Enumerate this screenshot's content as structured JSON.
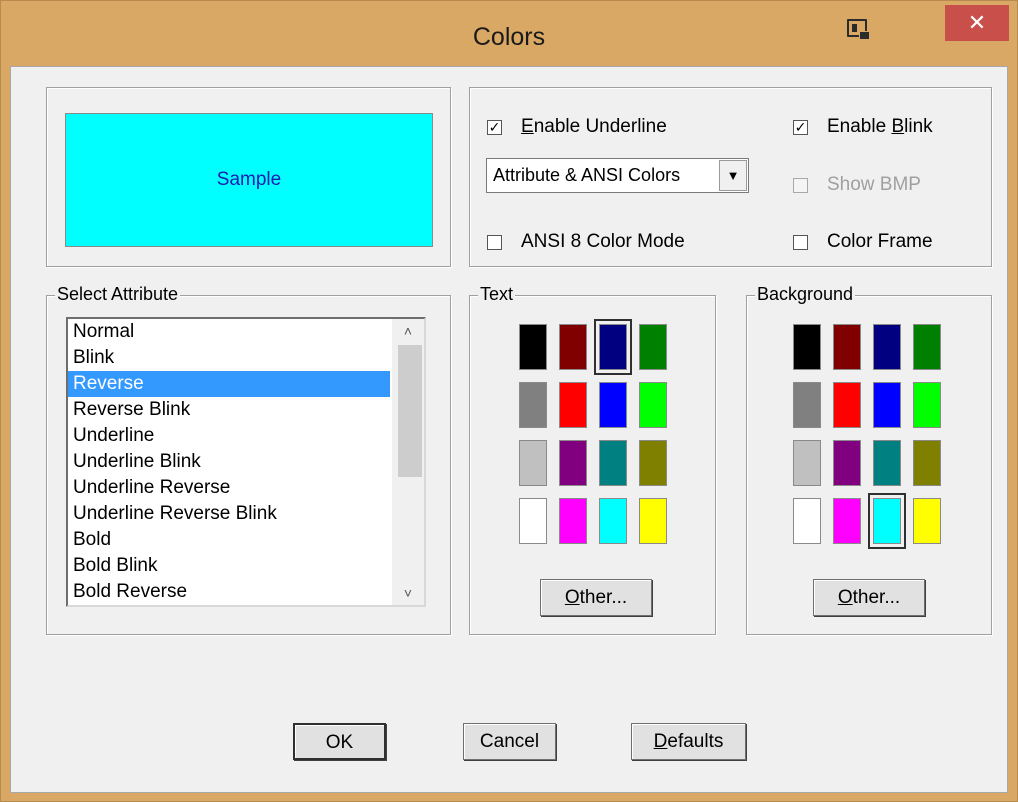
{
  "window": {
    "title": "Colors",
    "close_glyph": "✕",
    "icons": [
      "window-restore-icon",
      "close-icon"
    ]
  },
  "sample": {
    "label": "Sample",
    "background": "#00ffff",
    "text_color": "#1c1cb0"
  },
  "options": {
    "enable_underline": {
      "prefix": "",
      "accel": "E",
      "suffix": "nable Underline",
      "checked": true
    },
    "enable_blink": {
      "prefix": "Enable ",
      "accel": "B",
      "suffix": "link",
      "checked": true
    },
    "color_mode_combo": {
      "value": "Attribute & ANSI Colors"
    },
    "show_bmp": {
      "label": "Show BMP",
      "checked": false,
      "disabled": true
    },
    "ansi_8_color_mode": {
      "label": "ANSI 8 Color Mode",
      "checked": false
    },
    "color_frame": {
      "label": "Color Frame",
      "checked": false
    }
  },
  "select_attribute": {
    "label": "Select Attribute",
    "items": [
      "Normal",
      "Blink",
      "Reverse",
      "Reverse Blink",
      "Underline",
      "Underline Blink",
      "Underline Reverse",
      "Underline Reverse Blink",
      "Bold",
      "Bold Blink",
      "Bold Reverse"
    ],
    "selected": "Reverse"
  },
  "text_colors": {
    "label": "Text",
    "palette": [
      "#000000",
      "#800000",
      "#000080",
      "#008000",
      "#808080",
      "#ff0000",
      "#0000ff",
      "#00ff00",
      "#c0c0c0",
      "#800080",
      "#008080",
      "#808000",
      "#ffffff",
      "#ff00ff",
      "#00ffff",
      "#ffff00"
    ],
    "selected": "#000080",
    "other": {
      "accel": "O",
      "suffix": "ther..."
    }
  },
  "background_colors": {
    "label": "Background",
    "palette": [
      "#000000",
      "#800000",
      "#000080",
      "#008000",
      "#808080",
      "#ff0000",
      "#0000ff",
      "#00ff00",
      "#c0c0c0",
      "#800080",
      "#008080",
      "#808000",
      "#ffffff",
      "#ff00ff",
      "#00ffff",
      "#ffff00"
    ],
    "selected": "#00ffff",
    "other": {
      "accel": "O",
      "suffix": "ther..."
    }
  },
  "buttons": {
    "ok": "OK",
    "cancel": "Cancel",
    "defaults": {
      "accel": "D",
      "suffix": "efaults"
    }
  }
}
